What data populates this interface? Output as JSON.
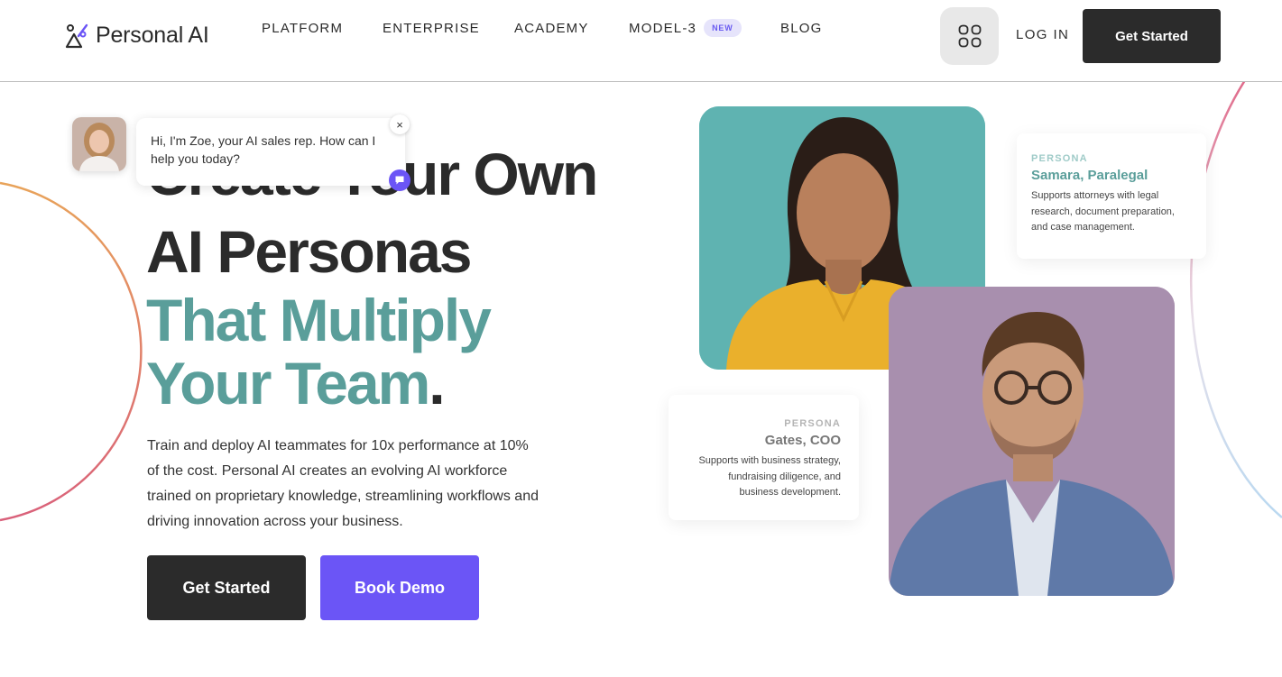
{
  "header": {
    "logo_text": "Personal AI",
    "nav": [
      {
        "label": "PLATFORM"
      },
      {
        "label": "ENTERPRISE"
      },
      {
        "label": "ACADEMY"
      },
      {
        "label": "MODEL-3",
        "badge": "NEW"
      },
      {
        "label": "BLOG"
      }
    ],
    "login_label": "LOG IN",
    "cta_label": "Get Started"
  },
  "chat": {
    "message": "Hi, I'm Zoe, your AI sales rep. How can I help you today?",
    "close_glyph": "×"
  },
  "hero": {
    "title_line1": "Create Your Own",
    "title_line2": "AI Personas",
    "title_line3": "That Multiply",
    "title_line4": "Your Team",
    "title_end": ".",
    "description": "Train and deploy AI teammates for 10x performance at 10% of the cost. Personal AI creates an evolving AI workforce trained on proprietary knowledge, streamlining workflows and driving innovation across your business.",
    "primary_button": "Get Started",
    "secondary_button": "Book Demo"
  },
  "personas": [
    {
      "label": "PERSONA",
      "name": "Samara, Paralegal",
      "description": "Supports attorneys with legal research, document preparation, and case management."
    },
    {
      "label": "PERSONA",
      "name": "Gates, COO",
      "description": "Supports with business strategy, fundraising diligence, and business development."
    }
  ],
  "colors": {
    "dark": "#2b2b2b",
    "teal": "#5a9e9a",
    "purple": "#6b55f6",
    "badge_bg": "#e6e4fb"
  },
  "icons": [
    "personal-ai-logo-icon",
    "apps-grid-icon",
    "close-icon",
    "chat-icon"
  ]
}
